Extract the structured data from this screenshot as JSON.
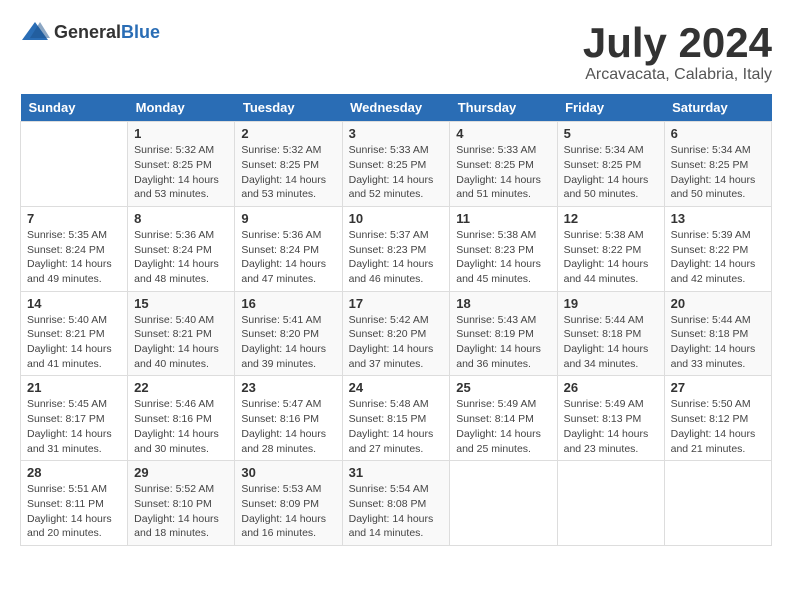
{
  "logo": {
    "text_general": "General",
    "text_blue": "Blue"
  },
  "header": {
    "month_year": "July 2024",
    "location": "Arcavacata, Calabria, Italy"
  },
  "days_of_week": [
    "Sunday",
    "Monday",
    "Tuesday",
    "Wednesday",
    "Thursday",
    "Friday",
    "Saturday"
  ],
  "weeks": [
    [
      {
        "day": "",
        "info": ""
      },
      {
        "day": "1",
        "info": "Sunrise: 5:32 AM\nSunset: 8:25 PM\nDaylight: 14 hours\nand 53 minutes."
      },
      {
        "day": "2",
        "info": "Sunrise: 5:32 AM\nSunset: 8:25 PM\nDaylight: 14 hours\nand 53 minutes."
      },
      {
        "day": "3",
        "info": "Sunrise: 5:33 AM\nSunset: 8:25 PM\nDaylight: 14 hours\nand 52 minutes."
      },
      {
        "day": "4",
        "info": "Sunrise: 5:33 AM\nSunset: 8:25 PM\nDaylight: 14 hours\nand 51 minutes."
      },
      {
        "day": "5",
        "info": "Sunrise: 5:34 AM\nSunset: 8:25 PM\nDaylight: 14 hours\nand 50 minutes."
      },
      {
        "day": "6",
        "info": "Sunrise: 5:34 AM\nSunset: 8:25 PM\nDaylight: 14 hours\nand 50 minutes."
      }
    ],
    [
      {
        "day": "7",
        "info": "Sunrise: 5:35 AM\nSunset: 8:24 PM\nDaylight: 14 hours\nand 49 minutes."
      },
      {
        "day": "8",
        "info": "Sunrise: 5:36 AM\nSunset: 8:24 PM\nDaylight: 14 hours\nand 48 minutes."
      },
      {
        "day": "9",
        "info": "Sunrise: 5:36 AM\nSunset: 8:24 PM\nDaylight: 14 hours\nand 47 minutes."
      },
      {
        "day": "10",
        "info": "Sunrise: 5:37 AM\nSunset: 8:23 PM\nDaylight: 14 hours\nand 46 minutes."
      },
      {
        "day": "11",
        "info": "Sunrise: 5:38 AM\nSunset: 8:23 PM\nDaylight: 14 hours\nand 45 minutes."
      },
      {
        "day": "12",
        "info": "Sunrise: 5:38 AM\nSunset: 8:22 PM\nDaylight: 14 hours\nand 44 minutes."
      },
      {
        "day": "13",
        "info": "Sunrise: 5:39 AM\nSunset: 8:22 PM\nDaylight: 14 hours\nand 42 minutes."
      }
    ],
    [
      {
        "day": "14",
        "info": "Sunrise: 5:40 AM\nSunset: 8:21 PM\nDaylight: 14 hours\nand 41 minutes."
      },
      {
        "day": "15",
        "info": "Sunrise: 5:40 AM\nSunset: 8:21 PM\nDaylight: 14 hours\nand 40 minutes."
      },
      {
        "day": "16",
        "info": "Sunrise: 5:41 AM\nSunset: 8:20 PM\nDaylight: 14 hours\nand 39 minutes."
      },
      {
        "day": "17",
        "info": "Sunrise: 5:42 AM\nSunset: 8:20 PM\nDaylight: 14 hours\nand 37 minutes."
      },
      {
        "day": "18",
        "info": "Sunrise: 5:43 AM\nSunset: 8:19 PM\nDaylight: 14 hours\nand 36 minutes."
      },
      {
        "day": "19",
        "info": "Sunrise: 5:44 AM\nSunset: 8:18 PM\nDaylight: 14 hours\nand 34 minutes."
      },
      {
        "day": "20",
        "info": "Sunrise: 5:44 AM\nSunset: 8:18 PM\nDaylight: 14 hours\nand 33 minutes."
      }
    ],
    [
      {
        "day": "21",
        "info": "Sunrise: 5:45 AM\nSunset: 8:17 PM\nDaylight: 14 hours\nand 31 minutes."
      },
      {
        "day": "22",
        "info": "Sunrise: 5:46 AM\nSunset: 8:16 PM\nDaylight: 14 hours\nand 30 minutes."
      },
      {
        "day": "23",
        "info": "Sunrise: 5:47 AM\nSunset: 8:16 PM\nDaylight: 14 hours\nand 28 minutes."
      },
      {
        "day": "24",
        "info": "Sunrise: 5:48 AM\nSunset: 8:15 PM\nDaylight: 14 hours\nand 27 minutes."
      },
      {
        "day": "25",
        "info": "Sunrise: 5:49 AM\nSunset: 8:14 PM\nDaylight: 14 hours\nand 25 minutes."
      },
      {
        "day": "26",
        "info": "Sunrise: 5:49 AM\nSunset: 8:13 PM\nDaylight: 14 hours\nand 23 minutes."
      },
      {
        "day": "27",
        "info": "Sunrise: 5:50 AM\nSunset: 8:12 PM\nDaylight: 14 hours\nand 21 minutes."
      }
    ],
    [
      {
        "day": "28",
        "info": "Sunrise: 5:51 AM\nSunset: 8:11 PM\nDaylight: 14 hours\nand 20 minutes."
      },
      {
        "day": "29",
        "info": "Sunrise: 5:52 AM\nSunset: 8:10 PM\nDaylight: 14 hours\nand 18 minutes."
      },
      {
        "day": "30",
        "info": "Sunrise: 5:53 AM\nSunset: 8:09 PM\nDaylight: 14 hours\nand 16 minutes."
      },
      {
        "day": "31",
        "info": "Sunrise: 5:54 AM\nSunset: 8:08 PM\nDaylight: 14 hours\nand 14 minutes."
      },
      {
        "day": "",
        "info": ""
      },
      {
        "day": "",
        "info": ""
      },
      {
        "day": "",
        "info": ""
      }
    ]
  ]
}
